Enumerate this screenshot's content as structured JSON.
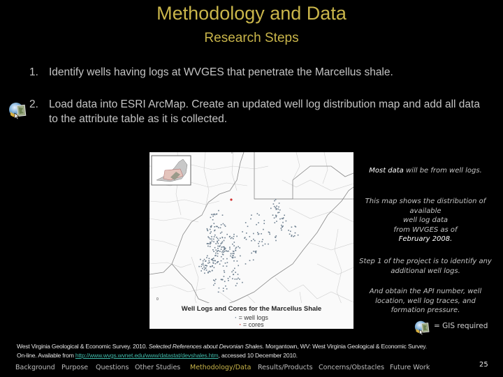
{
  "header": {
    "title": "Methodology and Data",
    "subtitle": "Research Steps"
  },
  "steps": [
    {
      "number": "1.",
      "text": "Identify wells having logs at WVGES that penetrate the Marcellus shale.",
      "gis_required": false
    },
    {
      "number": "2.",
      "text": "Load data into ESRI ArcMap.  Create an updated well log distribution map and add all data to the attribute table as it is collected.",
      "gis_required": true
    }
  ],
  "map": {
    "title": "Well Logs and Cores for the Marcellus Shale",
    "legend": [
      {
        "symbol": "·",
        "label": "= well logs",
        "color": "#6d7f8f"
      },
      {
        "symbol": "·",
        "label": "= cores",
        "color": "#d03030"
      }
    ]
  },
  "side_notes": {
    "note1_highlight": "Most data",
    "note1_rest": " will be from well logs.",
    "note2_lines": [
      "This map shows the distribution of",
      "available",
      "well log data",
      "from WVGES as of"
    ],
    "note2_date": "February 2008.",
    "note3": "Step 1 of the project is to identify any additional well logs.",
    "note4": "And obtain the API number, well location, well log traces, and formation pressure."
  },
  "gis_legend": {
    "icon": "arcgis-globe-map-icon",
    "label": "= GIS required"
  },
  "citation": {
    "part1": "West Virginia Geological & Economic Survey.  2010.  ",
    "title_italic": "Selected References about Devonian Shales.",
    "part2": "  Morgantown, WV: West Virginia Geological & Economic Survey.",
    "line2_prefix": "On-line.  Available from ",
    "url": "http://www.wvgs.wvnet.edu/www/datastat/devshales.htm",
    "line2_suffix": ", accessed 10 December 2010."
  },
  "nav": {
    "items": [
      {
        "label": "Background",
        "active": false
      },
      {
        "label": "Purpose",
        "active": false
      },
      {
        "label": "Questions",
        "active": false
      },
      {
        "label": "Other Studies",
        "active": false
      },
      {
        "label": "Methodology/Data",
        "active": true
      },
      {
        "label": "Results/Products",
        "active": false
      },
      {
        "label": "Concerns/Obstacles",
        "active": false
      },
      {
        "label": "Future Work",
        "active": false
      }
    ],
    "page_number": "25"
  },
  "colors": {
    "accent_gold": "#c9b54a",
    "link_teal": "#3fb8a8",
    "background": "#000000"
  }
}
